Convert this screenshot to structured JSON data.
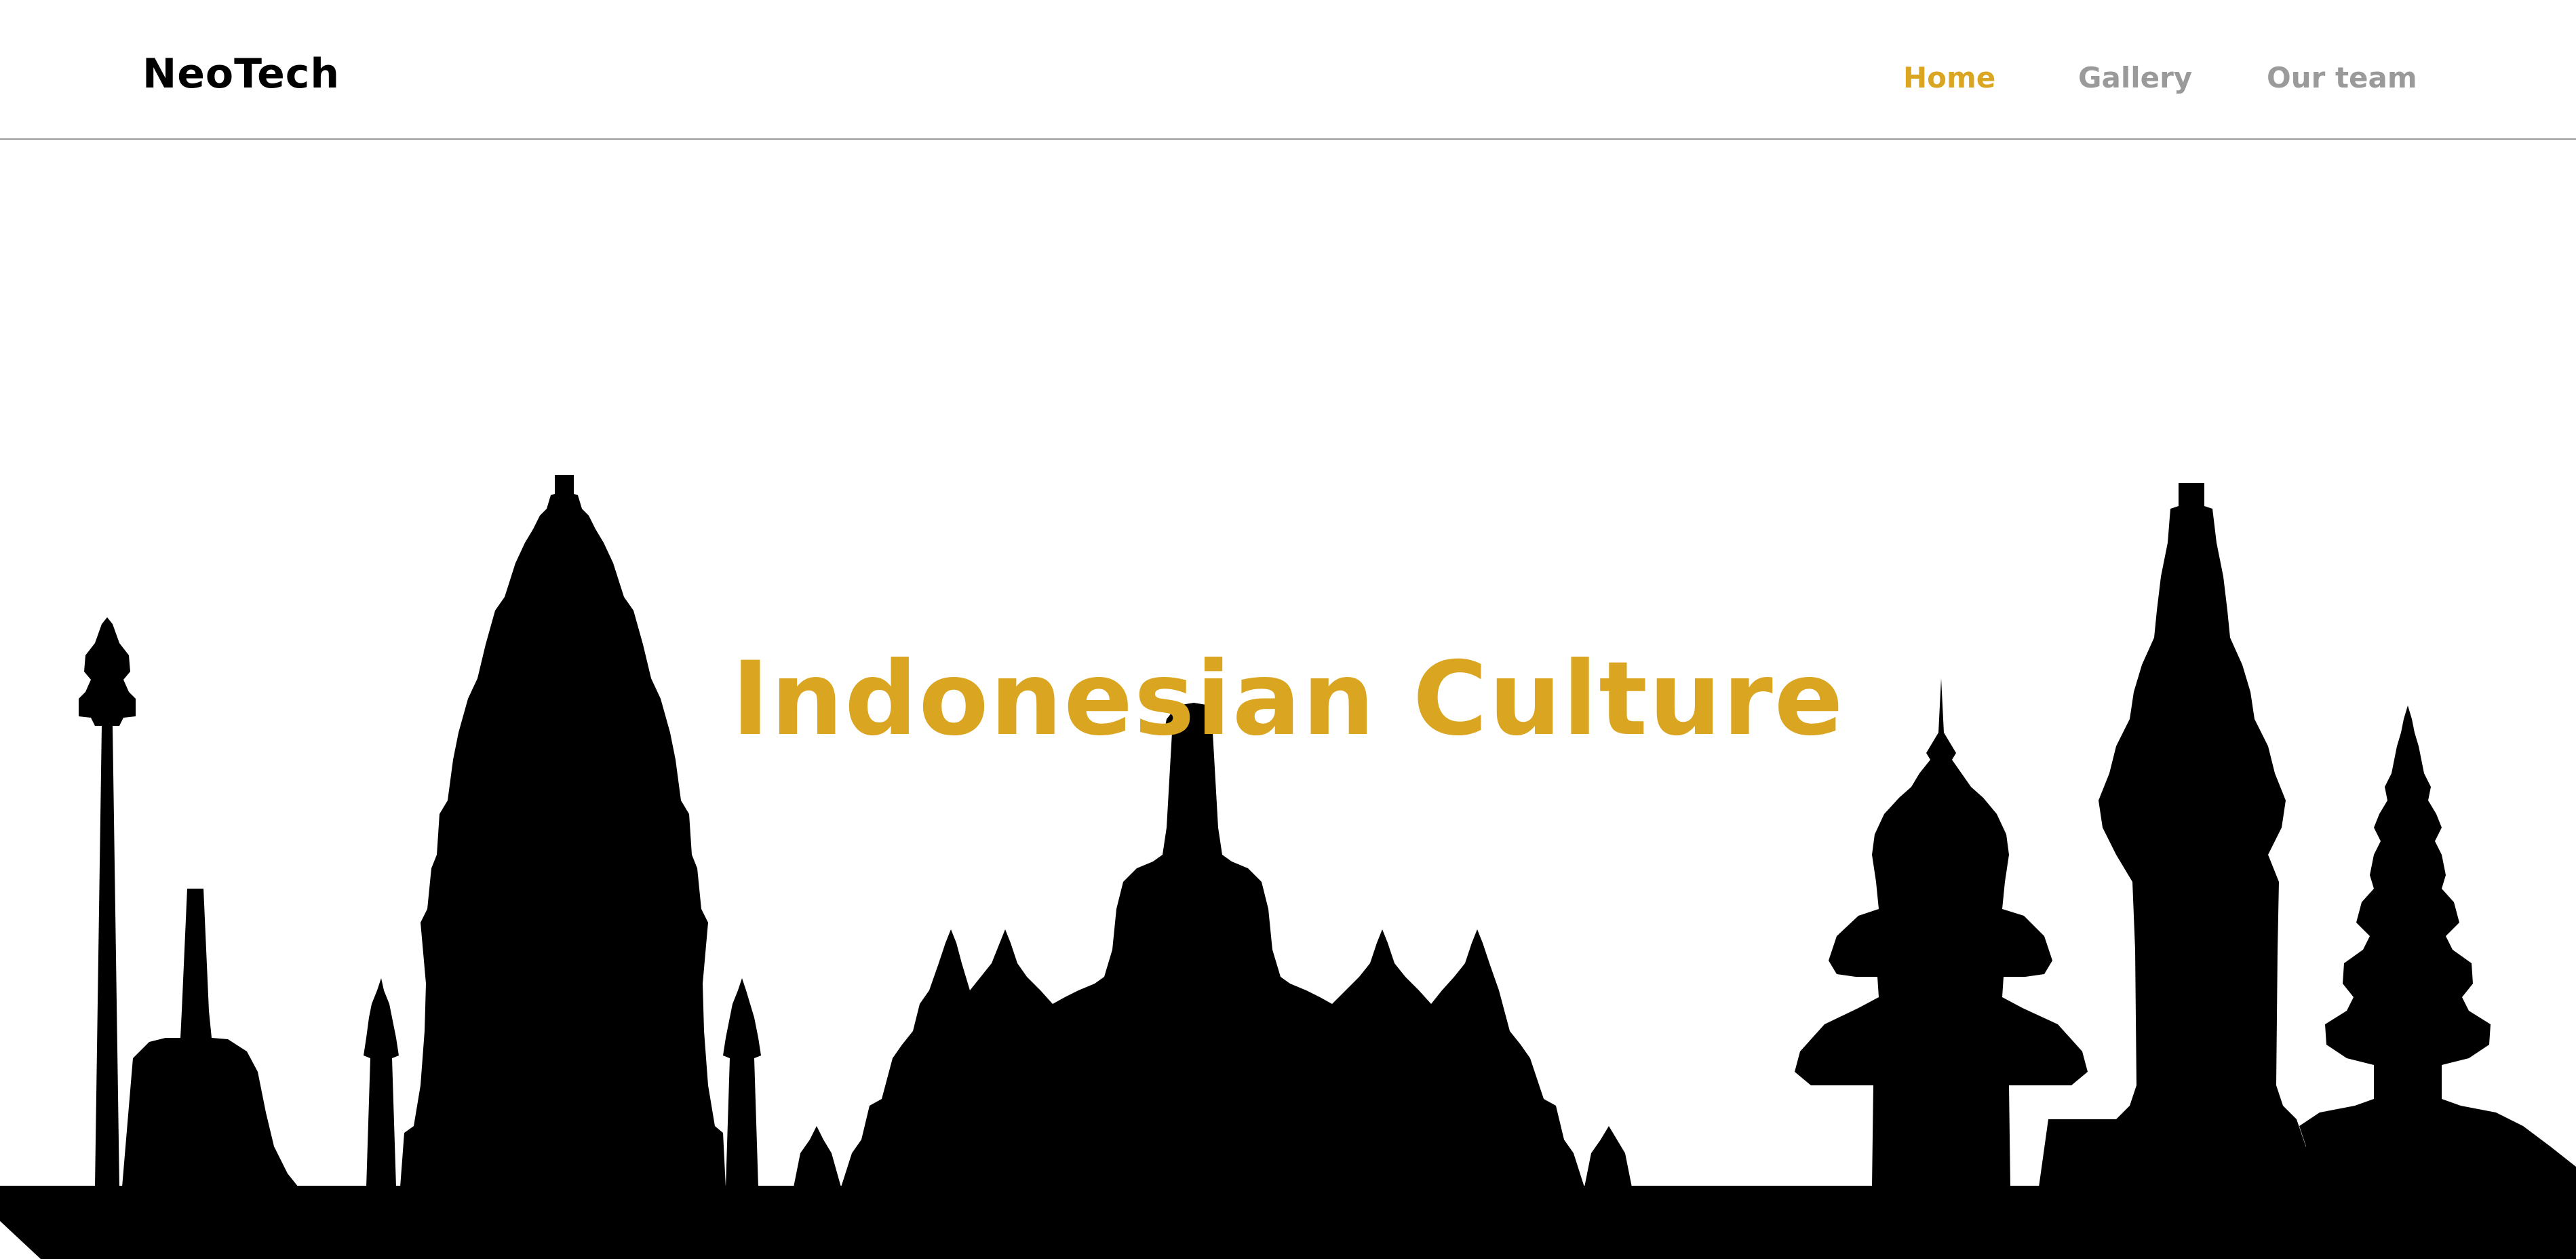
{
  "navbar": {
    "logo": "NeoTech",
    "links": [
      {
        "label": "Home",
        "active": true
      },
      {
        "label": "Gallery",
        "active": false
      },
      {
        "label": "Our team",
        "active": false
      }
    ]
  },
  "hero": {
    "title": "Indonesian Culture"
  },
  "colors": {
    "accent": "#daa520",
    "nav_inactive": "#9a9a9a",
    "text": "#000000",
    "background": "#ffffff",
    "silhouette": "#000000"
  }
}
